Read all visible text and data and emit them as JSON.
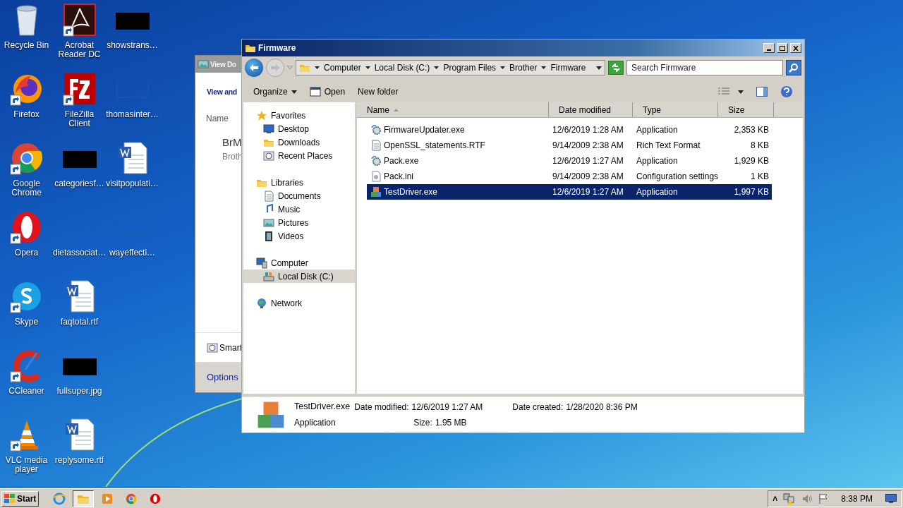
{
  "desktop_icons": [
    {
      "label": "Recycle Bin",
      "kind": "recycle",
      "shortcut": false
    },
    {
      "label": "Firefox",
      "kind": "firefox",
      "shortcut": true
    },
    {
      "label": "Google Chrome",
      "kind": "chrome",
      "shortcut": true
    },
    {
      "label": "Opera",
      "kind": "opera",
      "shortcut": true
    },
    {
      "label": "Skype",
      "kind": "skype",
      "shortcut": true
    },
    {
      "label": "CCleaner",
      "kind": "ccleaner",
      "shortcut": true
    },
    {
      "label": "VLC media player",
      "kind": "vlc",
      "shortcut": true
    },
    {
      "label": "Acrobat Reader DC",
      "kind": "acrobat",
      "shortcut": true
    },
    {
      "label": "FileZilla Client",
      "kind": "filezilla",
      "shortcut": true
    },
    {
      "label": "categoriesf…",
      "kind": "black",
      "shortcut": false
    },
    {
      "label": "dietassociat…",
      "kind": "blank",
      "shortcut": false
    },
    {
      "label": "faqtotal.rtf",
      "kind": "word",
      "shortcut": false
    },
    {
      "label": "fullsuper.jpg",
      "kind": "black",
      "shortcut": false
    },
    {
      "label": "replysome.rtf",
      "kind": "word",
      "shortcut": false
    },
    {
      "label": "showstrans…",
      "kind": "black",
      "shortcut": false
    },
    {
      "label": "thomasinter…",
      "kind": "blank",
      "shortcut": false
    },
    {
      "label": "visitpopulati…",
      "kind": "word",
      "shortcut": false
    },
    {
      "label": "wayeffecti…",
      "kind": "blank",
      "shortcut": false
    }
  ],
  "background_window": {
    "title": "View Do",
    "heading": "View and",
    "column": "Name",
    "item_title": "BrM",
    "item_subtitle": "Broth",
    "footer_item": "Smart",
    "options": "Options"
  },
  "explorer": {
    "title": "Firmware",
    "breadcrumb": [
      "Computer",
      "Local Disk (C:)",
      "Program Files",
      "Brother",
      "Firmware"
    ],
    "search": {
      "placeholder": "Search Firmware"
    },
    "toolbar": [
      "Organize",
      "Open",
      "New folder"
    ],
    "nav": [
      {
        "label": "Favorites",
        "kind": "star",
        "selected": false,
        "children": [
          {
            "label": "Desktop",
            "kind": "desktop",
            "selected": false
          },
          {
            "label": "Downloads",
            "kind": "downloads",
            "selected": false
          },
          {
            "label": "Recent Places",
            "kind": "recent",
            "selected": false
          }
        ]
      },
      {
        "label": "Libraries",
        "kind": "libraries",
        "selected": false,
        "children": [
          {
            "label": "Documents",
            "kind": "documents",
            "selected": false
          },
          {
            "label": "Music",
            "kind": "music",
            "selected": false
          },
          {
            "label": "Pictures",
            "kind": "pictures",
            "selected": false
          },
          {
            "label": "Videos",
            "kind": "videos",
            "selected": false
          }
        ]
      },
      {
        "label": "Computer",
        "kind": "computer",
        "selected": false,
        "children": [
          {
            "label": "Local Disk (C:)",
            "kind": "disk",
            "selected": true
          }
        ]
      },
      {
        "label": "Network",
        "kind": "network",
        "selected": false
      }
    ],
    "columns": [
      {
        "label": "Name",
        "sorted": true
      },
      {
        "label": "Date modified",
        "sorted": false
      },
      {
        "label": "Type",
        "sorted": false
      },
      {
        "label": "Size",
        "sorted": false
      }
    ],
    "files": [
      {
        "name": "FirmwareUpdater.exe",
        "date": "12/6/2019 1:28 AM",
        "type": "Application",
        "size": "2,353 KB",
        "kind": "exe",
        "selected": false
      },
      {
        "name": "OpenSSL_statements.RTF",
        "date": "9/14/2009 2:38 AM",
        "type": "Rich Text Format",
        "size": "8 KB",
        "kind": "rtf",
        "selected": false
      },
      {
        "name": "Pack.exe",
        "date": "12/6/2019 1:27 AM",
        "type": "Application",
        "size": "1,929 KB",
        "kind": "exe",
        "selected": false
      },
      {
        "name": "Pack.ini",
        "date": "9/14/2009 2:38 AM",
        "type": "Configuration settings",
        "size": "1 KB",
        "kind": "ini",
        "selected": false
      },
      {
        "name": "TestDriver.exe",
        "date": "12/6/2019 1:27 AM",
        "type": "Application",
        "size": "1,997 KB",
        "kind": "mfc",
        "selected": true
      }
    ],
    "details": {
      "name": "TestDriver.exe",
      "type": "Application",
      "modified_label": "Date modified:",
      "modified": "12/6/2019 1:27 AM",
      "size_label": "Size:",
      "size": "1.95 MB",
      "created_label": "Date created:",
      "created": "1/28/2020 8:36 PM"
    }
  },
  "taskbar": {
    "start": "Start",
    "apps": [
      {
        "kind": "ie",
        "selected": false
      },
      {
        "kind": "explorer",
        "selected": true
      },
      {
        "kind": "media",
        "selected": false
      },
      {
        "kind": "chrome",
        "selected": false
      },
      {
        "kind": "opera",
        "selected": false
      }
    ],
    "tray_toggle": "˄",
    "clock": "8:38 PM"
  }
}
